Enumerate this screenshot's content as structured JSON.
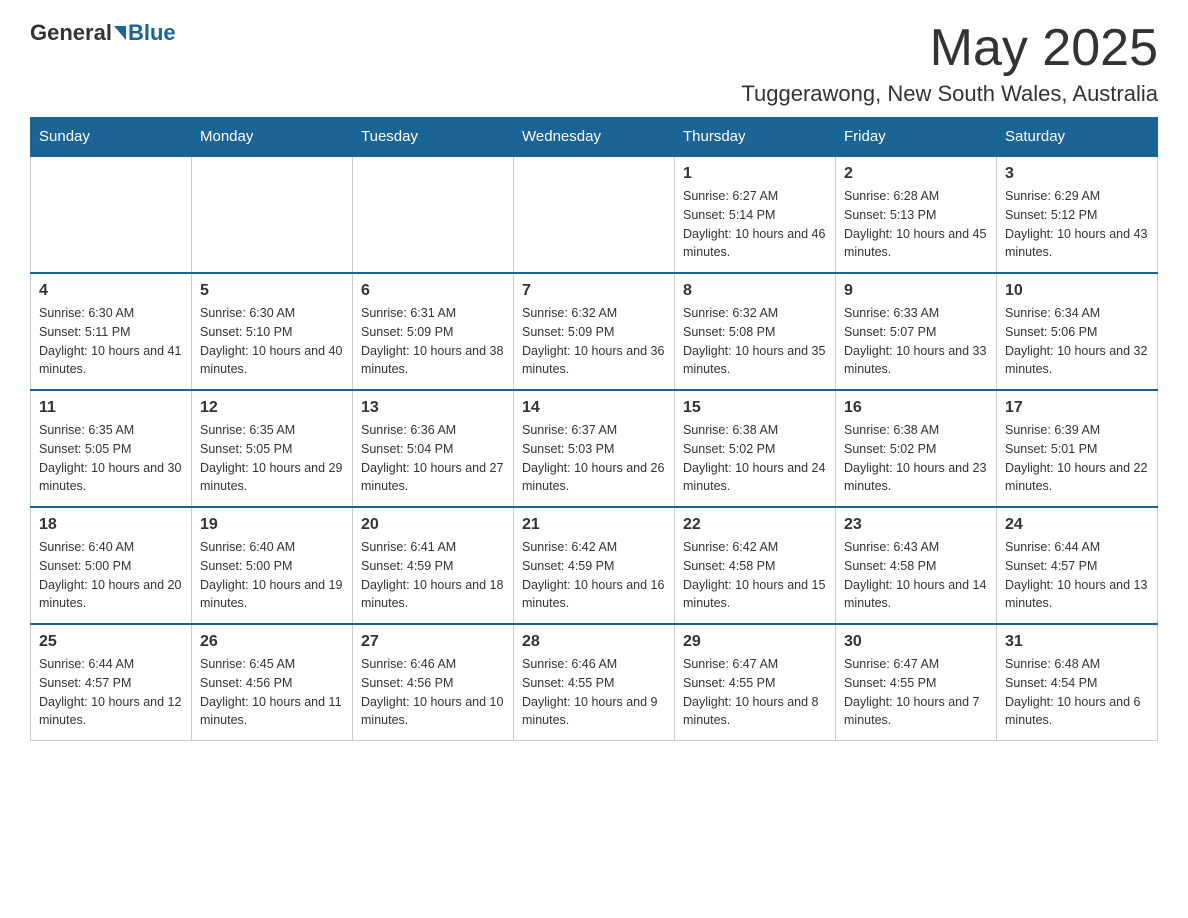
{
  "logo": {
    "general": "General",
    "blue": "Blue"
  },
  "header": {
    "month": "May 2025",
    "location": "Tuggerawong, New South Wales, Australia"
  },
  "days_of_week": [
    "Sunday",
    "Monday",
    "Tuesday",
    "Wednesday",
    "Thursday",
    "Friday",
    "Saturday"
  ],
  "weeks": [
    [
      {
        "day": "",
        "info": ""
      },
      {
        "day": "",
        "info": ""
      },
      {
        "day": "",
        "info": ""
      },
      {
        "day": "",
        "info": ""
      },
      {
        "day": "1",
        "info": "Sunrise: 6:27 AM\nSunset: 5:14 PM\nDaylight: 10 hours and 46 minutes."
      },
      {
        "day": "2",
        "info": "Sunrise: 6:28 AM\nSunset: 5:13 PM\nDaylight: 10 hours and 45 minutes."
      },
      {
        "day": "3",
        "info": "Sunrise: 6:29 AM\nSunset: 5:12 PM\nDaylight: 10 hours and 43 minutes."
      }
    ],
    [
      {
        "day": "4",
        "info": "Sunrise: 6:30 AM\nSunset: 5:11 PM\nDaylight: 10 hours and 41 minutes."
      },
      {
        "day": "5",
        "info": "Sunrise: 6:30 AM\nSunset: 5:10 PM\nDaylight: 10 hours and 40 minutes."
      },
      {
        "day": "6",
        "info": "Sunrise: 6:31 AM\nSunset: 5:09 PM\nDaylight: 10 hours and 38 minutes."
      },
      {
        "day": "7",
        "info": "Sunrise: 6:32 AM\nSunset: 5:09 PM\nDaylight: 10 hours and 36 minutes."
      },
      {
        "day": "8",
        "info": "Sunrise: 6:32 AM\nSunset: 5:08 PM\nDaylight: 10 hours and 35 minutes."
      },
      {
        "day": "9",
        "info": "Sunrise: 6:33 AM\nSunset: 5:07 PM\nDaylight: 10 hours and 33 minutes."
      },
      {
        "day": "10",
        "info": "Sunrise: 6:34 AM\nSunset: 5:06 PM\nDaylight: 10 hours and 32 minutes."
      }
    ],
    [
      {
        "day": "11",
        "info": "Sunrise: 6:35 AM\nSunset: 5:05 PM\nDaylight: 10 hours and 30 minutes."
      },
      {
        "day": "12",
        "info": "Sunrise: 6:35 AM\nSunset: 5:05 PM\nDaylight: 10 hours and 29 minutes."
      },
      {
        "day": "13",
        "info": "Sunrise: 6:36 AM\nSunset: 5:04 PM\nDaylight: 10 hours and 27 minutes."
      },
      {
        "day": "14",
        "info": "Sunrise: 6:37 AM\nSunset: 5:03 PM\nDaylight: 10 hours and 26 minutes."
      },
      {
        "day": "15",
        "info": "Sunrise: 6:38 AM\nSunset: 5:02 PM\nDaylight: 10 hours and 24 minutes."
      },
      {
        "day": "16",
        "info": "Sunrise: 6:38 AM\nSunset: 5:02 PM\nDaylight: 10 hours and 23 minutes."
      },
      {
        "day": "17",
        "info": "Sunrise: 6:39 AM\nSunset: 5:01 PM\nDaylight: 10 hours and 22 minutes."
      }
    ],
    [
      {
        "day": "18",
        "info": "Sunrise: 6:40 AM\nSunset: 5:00 PM\nDaylight: 10 hours and 20 minutes."
      },
      {
        "day": "19",
        "info": "Sunrise: 6:40 AM\nSunset: 5:00 PM\nDaylight: 10 hours and 19 minutes."
      },
      {
        "day": "20",
        "info": "Sunrise: 6:41 AM\nSunset: 4:59 PM\nDaylight: 10 hours and 18 minutes."
      },
      {
        "day": "21",
        "info": "Sunrise: 6:42 AM\nSunset: 4:59 PM\nDaylight: 10 hours and 16 minutes."
      },
      {
        "day": "22",
        "info": "Sunrise: 6:42 AM\nSunset: 4:58 PM\nDaylight: 10 hours and 15 minutes."
      },
      {
        "day": "23",
        "info": "Sunrise: 6:43 AM\nSunset: 4:58 PM\nDaylight: 10 hours and 14 minutes."
      },
      {
        "day": "24",
        "info": "Sunrise: 6:44 AM\nSunset: 4:57 PM\nDaylight: 10 hours and 13 minutes."
      }
    ],
    [
      {
        "day": "25",
        "info": "Sunrise: 6:44 AM\nSunset: 4:57 PM\nDaylight: 10 hours and 12 minutes."
      },
      {
        "day": "26",
        "info": "Sunrise: 6:45 AM\nSunset: 4:56 PM\nDaylight: 10 hours and 11 minutes."
      },
      {
        "day": "27",
        "info": "Sunrise: 6:46 AM\nSunset: 4:56 PM\nDaylight: 10 hours and 10 minutes."
      },
      {
        "day": "28",
        "info": "Sunrise: 6:46 AM\nSunset: 4:55 PM\nDaylight: 10 hours and 9 minutes."
      },
      {
        "day": "29",
        "info": "Sunrise: 6:47 AM\nSunset: 4:55 PM\nDaylight: 10 hours and 8 minutes."
      },
      {
        "day": "30",
        "info": "Sunrise: 6:47 AM\nSunset: 4:55 PM\nDaylight: 10 hours and 7 minutes."
      },
      {
        "day": "31",
        "info": "Sunrise: 6:48 AM\nSunset: 4:54 PM\nDaylight: 10 hours and 6 minutes."
      }
    ]
  ]
}
